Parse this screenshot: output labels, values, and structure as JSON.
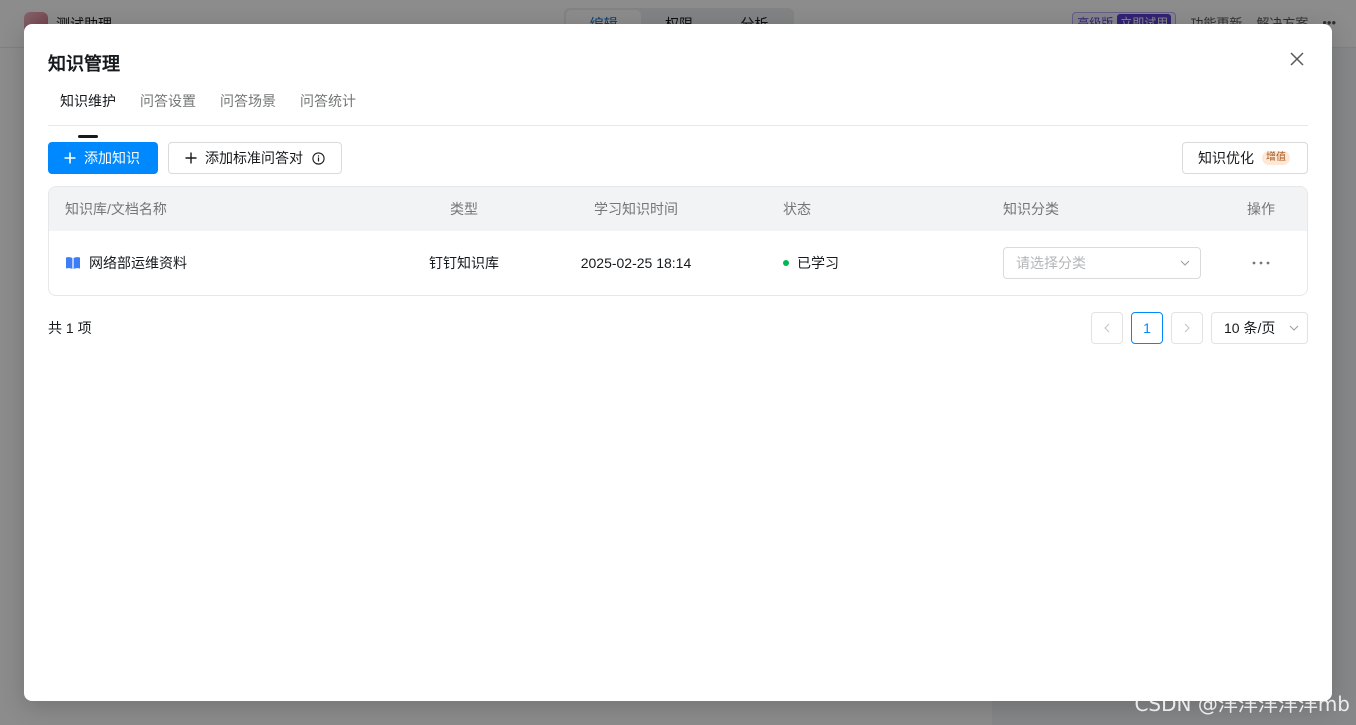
{
  "background": {
    "app_title": "测试助理",
    "tabs": [
      "编辑",
      "权限",
      "分析"
    ],
    "edition_label": "高级版",
    "edition_trial": "立即试用",
    "links": [
      "功能更新",
      "解决方案"
    ]
  },
  "modal": {
    "title": "知识管理",
    "tabs": [
      "知识维护",
      "问答设置",
      "问答场景",
      "问答统计"
    ],
    "active_tab": "知识维护"
  },
  "toolbar": {
    "add_knowledge_label": "添加知识",
    "add_qa_label": "添加标准问答对",
    "optimize_label": "知识优化",
    "optimize_tag": "增值"
  },
  "table": {
    "columns": [
      "知识库/文档名称",
      "类型",
      "学习知识时间",
      "状态",
      "知识分类",
      "操作"
    ],
    "rows": [
      {
        "name": "网络部运维资料",
        "type": "钉钉知识库",
        "time": "2025-02-25 18:14",
        "status": "已学习",
        "category_placeholder": "请选择分类"
      }
    ]
  },
  "pagination": {
    "total_label": "共 1 项",
    "current_page": "1",
    "page_size": "10 条/页"
  },
  "watermark": "CSDN @洋洋洋洋洋mb",
  "colors": {
    "primary": "#0089ff",
    "status_learned": "#00b853",
    "tag_bg": "#ffe8d6"
  }
}
